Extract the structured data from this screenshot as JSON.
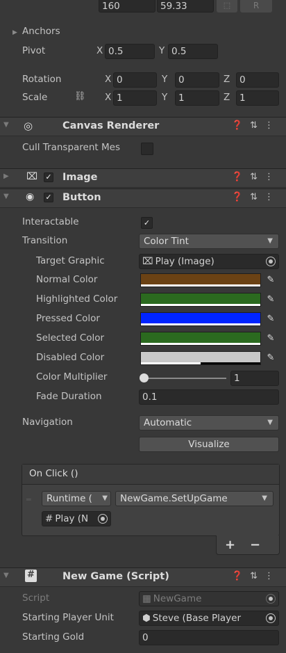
{
  "top_fields": {
    "width": "160",
    "height": "59.33",
    "raw_label": "R"
  },
  "anchors": {
    "label": "Anchors"
  },
  "pivot": {
    "label": "Pivot",
    "x_axis": "X",
    "x": "0.5",
    "y_axis": "Y",
    "y": "0.5"
  },
  "rotation": {
    "label": "Rotation",
    "x_axis": "X",
    "x": "0",
    "y_axis": "Y",
    "y": "0",
    "z_axis": "Z",
    "z": "0"
  },
  "scale": {
    "label": "Scale",
    "x_axis": "X",
    "x": "1",
    "y_axis": "Y",
    "y": "1",
    "z_axis": "Z",
    "z": "1"
  },
  "canvas_renderer": {
    "title": "Canvas Renderer",
    "cull_label": "Cull Transparent Mes"
  },
  "image_component": {
    "title": "Image"
  },
  "button_component": {
    "title": "Button",
    "interactable_label": "Interactable",
    "transition_label": "Transition",
    "transition_value": "Color Tint",
    "target_graphic_label": "Target Graphic",
    "target_graphic_value": "Play (Image)",
    "normal_color_label": "Normal Color",
    "highlighted_color_label": "Highlighted Color",
    "pressed_color_label": "Pressed Color",
    "selected_color_label": "Selected Color",
    "disabled_color_label": "Disabled Color",
    "color_multiplier_label": "Color Multiplier",
    "color_multiplier_value": "1",
    "fade_duration_label": "Fade Duration",
    "fade_duration_value": "0.1",
    "navigation_label": "Navigation",
    "navigation_value": "Automatic",
    "visualize_label": "Visualize",
    "on_click_label": "On Click ()",
    "runtime_value": "Runtime (",
    "function_value": "NewGame.SetUpGame",
    "object_value": "Play (N",
    "add_label": "+",
    "remove_label": "−"
  },
  "colors": {
    "normal": "#6b4214",
    "highlighted": "#2b6a1f",
    "pressed": "#0024ff",
    "selected": "#2b6a1f",
    "disabled": "#c8c8c8"
  },
  "color_multiplier_level": 0,
  "new_game_script": {
    "title": "New Game (Script)",
    "script_label": "Script",
    "script_value": "NewGame",
    "starting_unit_label": "Starting Player Unit",
    "starting_unit_value": "Steve (Base Player",
    "starting_gold_label": "Starting Gold",
    "starting_gold_value": "0"
  },
  "icons": [
    "help-icon",
    "preset-icon",
    "kebab-menu-icon",
    "eye-icon",
    "image-icon",
    "button-icon",
    "script-icon",
    "link-icon",
    "eyedropper-icon",
    "target-icon",
    "prefab-icon"
  ]
}
